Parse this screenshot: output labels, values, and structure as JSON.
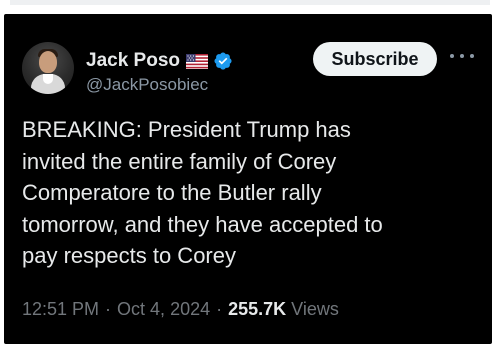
{
  "tweet": {
    "author": {
      "display_name": "Jack Poso",
      "handle": "@JackPosobiec",
      "flag_icon": "us-flag-icon",
      "verified_icon": "verified-badge-icon",
      "verified_color": "#1d9bf0"
    },
    "subscribe_label": "Subscribe",
    "more_icon": "more-options-icon",
    "text_lines": [
      "BREAKING: President Trump has",
      "invited the entire family of Corey",
      "Comperatore to the Butler rally",
      "tomorrow, and they have accepted to",
      "pay respects to Corey"
    ],
    "meta": {
      "time": "12:51 PM",
      "date": "Oct 4, 2024",
      "separator": "·",
      "views_count": "255.7K",
      "views_label": "Views"
    }
  },
  "colors": {
    "background": "#000000",
    "text": "#e7e9ea",
    "muted": "#71767b",
    "button_bg": "#eff3f4"
  }
}
